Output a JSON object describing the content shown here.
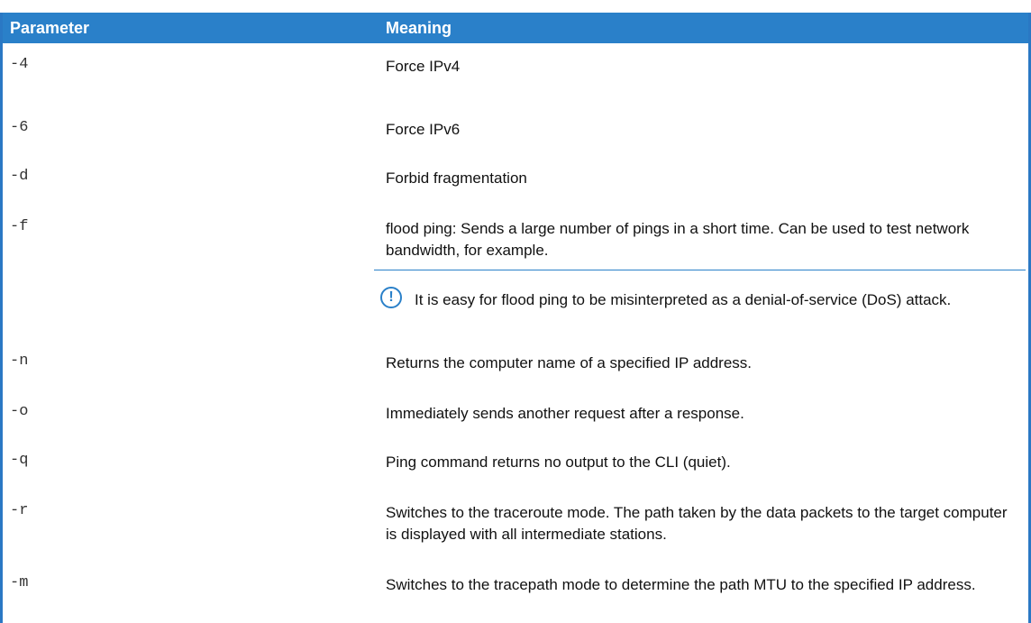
{
  "table": {
    "headers": {
      "parameter": "Parameter",
      "meaning": "Meaning"
    },
    "rows": [
      {
        "param": "-4",
        "meaning": "Force IPv4"
      },
      {
        "param": "-6",
        "meaning": "Force IPv6"
      },
      {
        "param": "-d",
        "meaning": "Forbid fragmentation"
      },
      {
        "param": "-f",
        "meaning": "flood ping: Sends a large number of pings in a short time. Can be used to test network bandwidth, for example."
      },
      {
        "param": "-n",
        "meaning": "Returns the computer name of a specified IP address."
      },
      {
        "param": "-o",
        "meaning": "Immediately sends another request after a response."
      },
      {
        "param": "-q",
        "meaning": "Ping command returns no output to the CLI (quiet)."
      },
      {
        "param": "-r",
        "meaning": "Switches to the traceroute mode. The path taken by the data packets to the target computer is displayed with all intermediate stations."
      },
      {
        "param": "-m",
        "meaning": "Switches to the tracepath mode to determine the path MTU to the specified IP address."
      }
    ],
    "note": {
      "icon": "exclamation-circle-icon",
      "icon_glyph": "!",
      "text": "It is easy for flood ping to be misinterpreted as a denial-of-service (DoS) attack."
    }
  }
}
